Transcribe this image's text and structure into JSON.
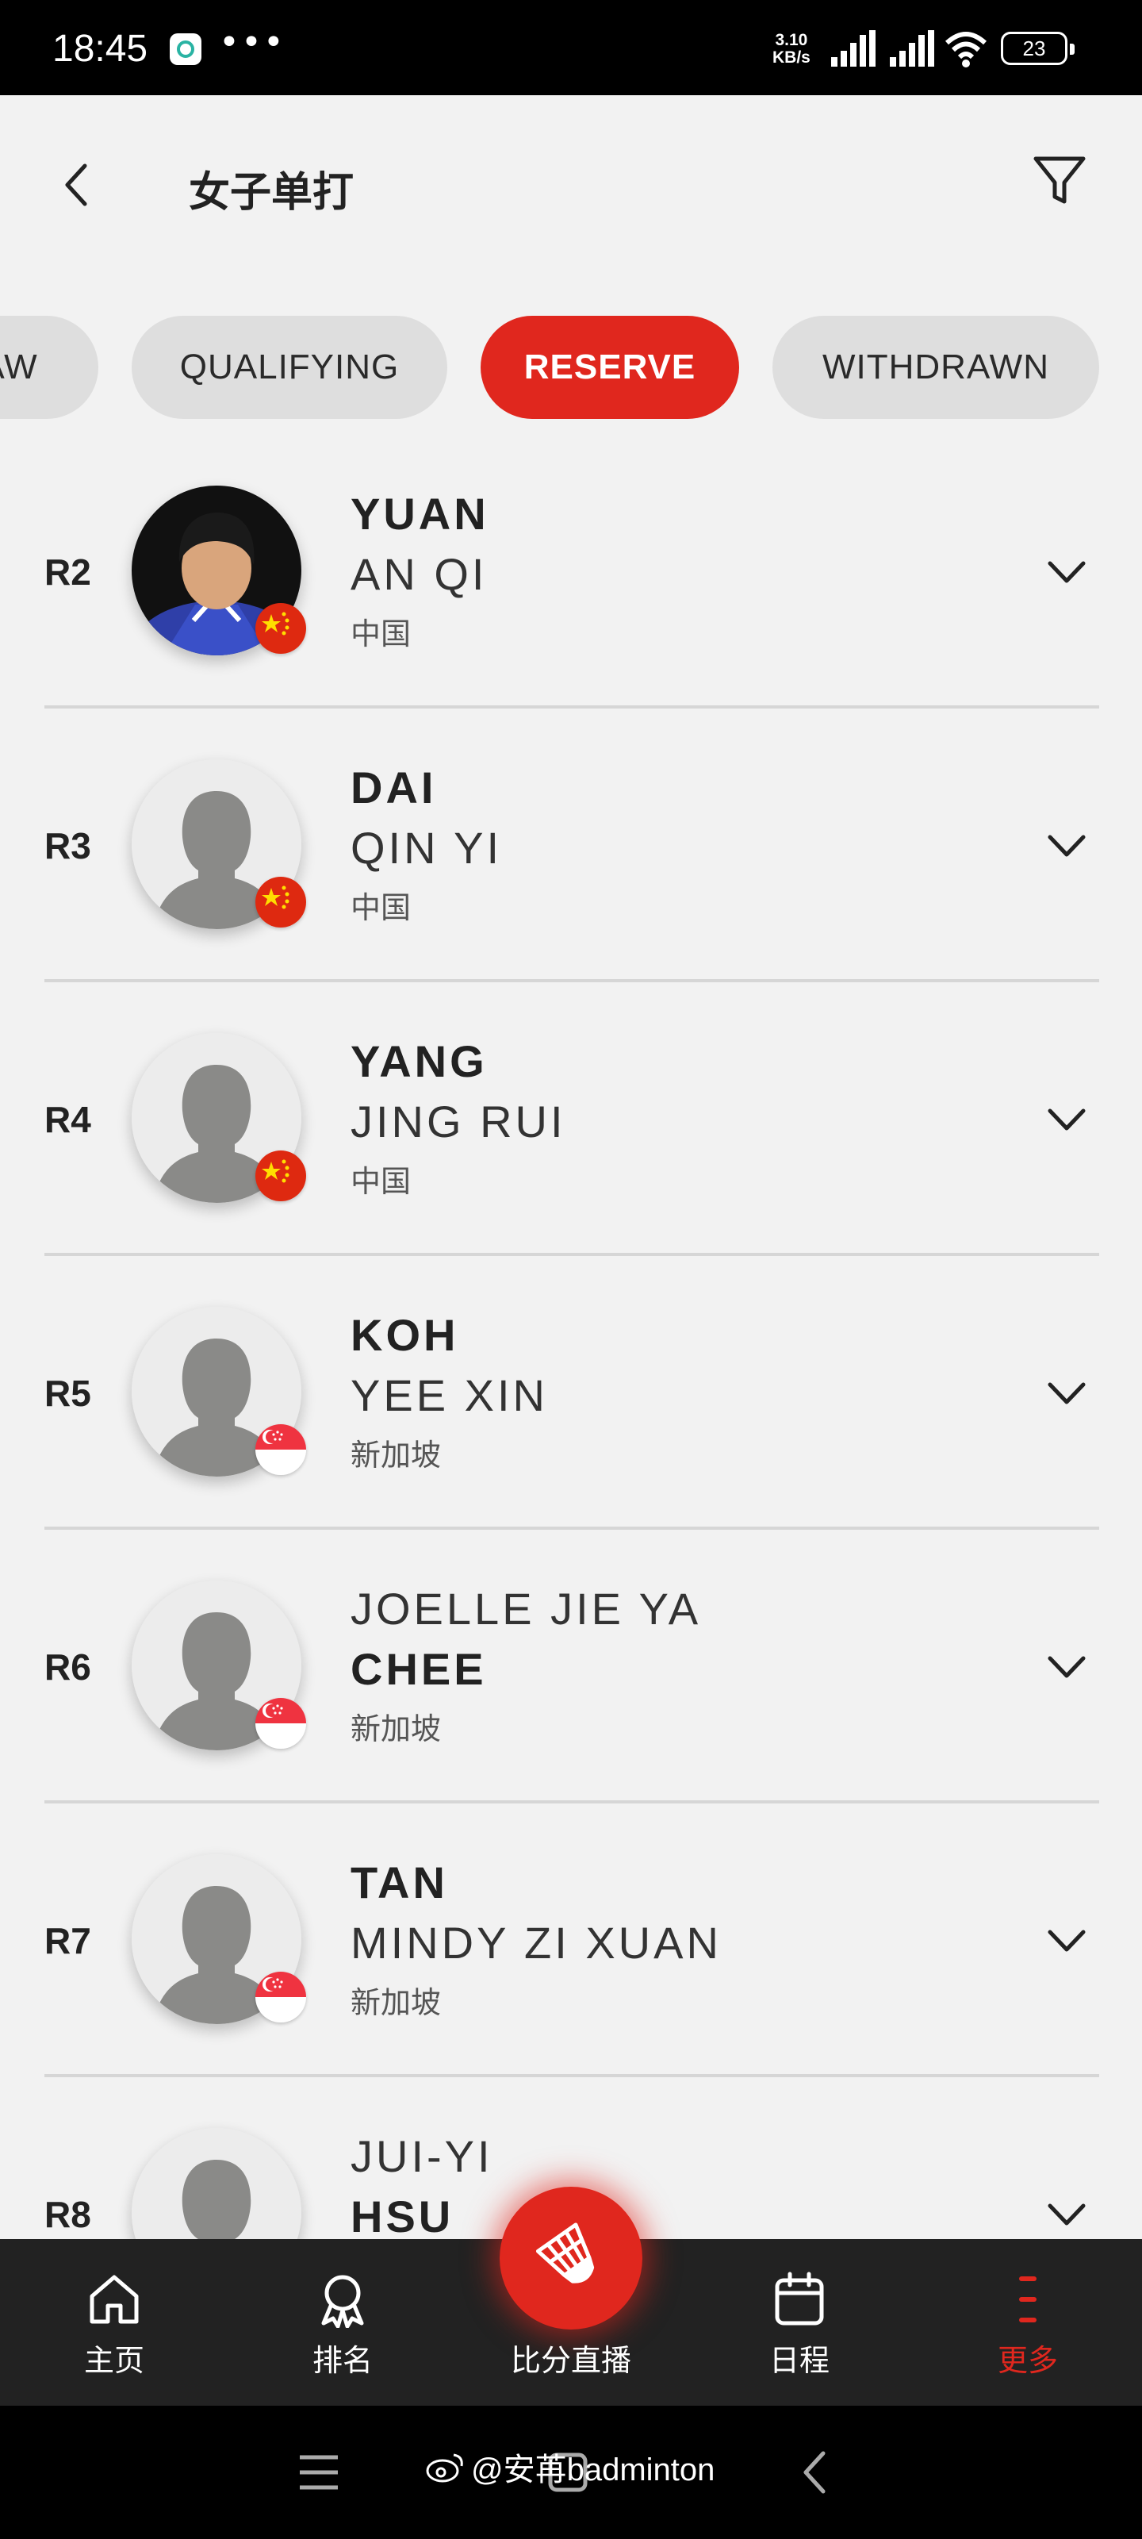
{
  "status_bar": {
    "time": "18:45",
    "dots": "•••",
    "speed_value": "3.10",
    "speed_unit": "KB/s",
    "battery": "23"
  },
  "header": {
    "title": "女子单打"
  },
  "tabs": [
    {
      "label": "AW",
      "active": false
    },
    {
      "label": "QUALIFYING",
      "active": false
    },
    {
      "label": "RESERVE",
      "active": true
    },
    {
      "label": "WITHDRAWN",
      "active": false
    }
  ],
  "players": [
    {
      "rank": "R2",
      "line1": "YUAN",
      "line2": "AN QI",
      "line1_bold": true,
      "country": "中国",
      "flag": "china",
      "has_photo": true
    },
    {
      "rank": "R3",
      "line1": "DAI",
      "line2": "QIN YI",
      "line1_bold": true,
      "country": "中国",
      "flag": "china",
      "has_photo": false
    },
    {
      "rank": "R4",
      "line1": "YANG",
      "line2": "JING RUI",
      "line1_bold": true,
      "country": "中国",
      "flag": "china",
      "has_photo": false
    },
    {
      "rank": "R5",
      "line1": "KOH",
      "line2": "YEE XIN",
      "line1_bold": true,
      "country": "新加坡",
      "flag": "singapore",
      "has_photo": false
    },
    {
      "rank": "R6",
      "line1": "JOELLE JIE YA",
      "line2": "CHEE",
      "line1_bold": false,
      "country": "新加坡",
      "flag": "singapore",
      "has_photo": false
    },
    {
      "rank": "R7",
      "line1": "TAN",
      "line2": "MINDY ZI XUAN",
      "line1_bold": true,
      "country": "新加坡",
      "flag": "singapore",
      "has_photo": false
    },
    {
      "rank": "R8",
      "line1": "JUI-YI",
      "line2": "HSU",
      "line1_bold": false,
      "country": "",
      "flag": "",
      "has_photo": false
    }
  ],
  "bottom_nav": {
    "home": "主页",
    "ranking": "排名",
    "live_scores": "比分直播",
    "schedule": "日程",
    "more": "更多"
  },
  "watermark": "@安苒badminton",
  "colors": {
    "accent": "#e0271e",
    "nav_background": "#222222",
    "page_background": "#f2f2f2"
  }
}
